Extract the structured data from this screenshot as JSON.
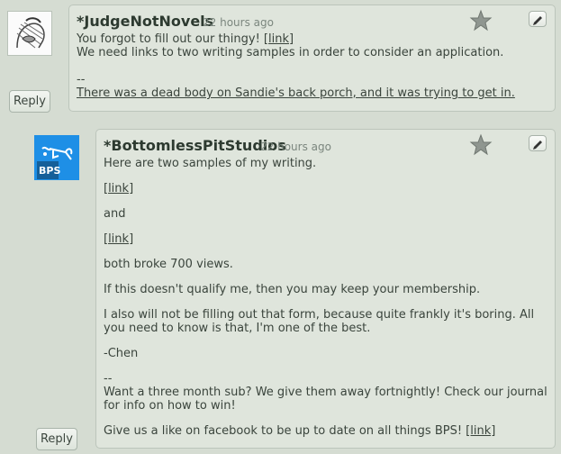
{
  "comments": [
    {
      "author": "*JudgeNotNovels",
      "time": "22 hours ago",
      "line1": "You forgot to fill out our thingy! ",
      "line1_link": "[link]",
      "line2": "We need links to two writing samples in order to consider an application.",
      "sig_sep": "--",
      "signature": "There was a dead body on Sandie's back porch, and it was trying to get in.",
      "reply_label": "Reply"
    },
    {
      "author": "*BottomlessPitStudios",
      "time": "22 hours ago",
      "avatar_text": "BPS",
      "p1": "Here are two samples of my writing.",
      "link1": "[link]",
      "and": "and",
      "link2": "[link]",
      "views": "both broke 700 views.",
      "qualify": "If this doesn't qualify me, then you may keep your membership.",
      "form": "I also will not be filling out that form, because quite frankly it's boring. All you need to know is that, I'm one of the best.",
      "name": "-Chen",
      "sig_sep": "--",
      "sig1": "Want a three month sub? We give them away fortnightly! Check our journal for info on how to win!",
      "sig2": "Give us a like on facebook to be up to date on all things BPS! ",
      "sig2_link": "[link]",
      "reply_label": "Reply"
    }
  ],
  "colors": {
    "background": "#d5dcd2",
    "panel": "#dfe5dc",
    "text": "#3a443c",
    "avatar_blue": "#1e8fe6"
  },
  "icons": [
    "avatar-sketch",
    "bps-logo",
    "star-icon",
    "pencil-icon"
  ]
}
